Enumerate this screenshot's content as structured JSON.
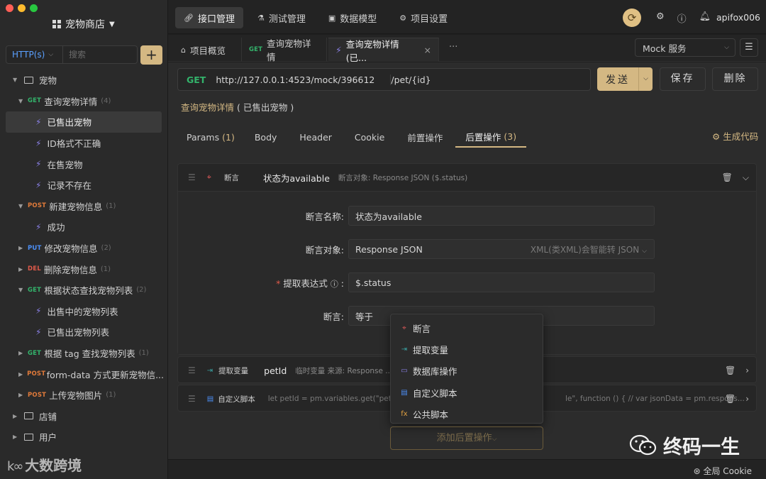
{
  "window": {
    "traffic_colors": [
      "#ff5f57",
      "#febc2e",
      "#28c840"
    ]
  },
  "sidebar": {
    "project_name": "宠物商店",
    "http_select": "HTTP(s)",
    "search_placeholder": "搜索",
    "add_label": "+",
    "tree": [
      {
        "type": "folder",
        "label": "宠物",
        "expanded": true
      },
      {
        "type": "api",
        "method": "GET",
        "label": "查询宠物详情",
        "count": "(4)",
        "expanded": true
      },
      {
        "type": "case",
        "label": "已售出宠物",
        "active": true
      },
      {
        "type": "case",
        "label": "ID格式不正确"
      },
      {
        "type": "case",
        "label": "在售宠物"
      },
      {
        "type": "case",
        "label": "记录不存在"
      },
      {
        "type": "api",
        "method": "POST",
        "label": "新建宠物信息",
        "count": "(1)",
        "expanded": true
      },
      {
        "type": "case",
        "label": "成功"
      },
      {
        "type": "api",
        "method": "PUT",
        "label": "修改宠物信息",
        "count": "(2)",
        "expanded": false
      },
      {
        "type": "api",
        "method": "DEL",
        "label": "删除宠物信息",
        "count": "(1)",
        "expanded": false
      },
      {
        "type": "api",
        "method": "GET",
        "label": "根据状态查找宠物列表",
        "count": "(2)",
        "expanded": true
      },
      {
        "type": "case",
        "label": "出售中的宠物列表"
      },
      {
        "type": "case",
        "label": "已售出宠物列表"
      },
      {
        "type": "api",
        "method": "GET",
        "label": "根据 tag 查找宠物列表",
        "count": "(1)",
        "expanded": false
      },
      {
        "type": "api",
        "method": "POST",
        "label": "form-data 方式更新宠物信...",
        "count": "",
        "expanded": false
      },
      {
        "type": "api",
        "method": "POST",
        "label": "上传宠物图片",
        "count": "(1)",
        "expanded": false
      },
      {
        "type": "folder",
        "label": "店铺",
        "expanded": false
      },
      {
        "type": "folder",
        "label": "用户",
        "expanded": false
      }
    ],
    "watermark": "大数跨境"
  },
  "topnav": {
    "items": [
      {
        "label": "接口管理",
        "icon": "link-icon",
        "active": true
      },
      {
        "label": "测试管理",
        "icon": "flask-icon",
        "active": false
      },
      {
        "label": "数据模型",
        "icon": "cube-icon",
        "active": false
      },
      {
        "label": "项目设置",
        "icon": "gear-icon",
        "active": false
      }
    ],
    "username": "apifox006"
  },
  "tabs": {
    "items": [
      {
        "label": "项目概览",
        "prefix": ""
      },
      {
        "label": "查询宠物详情",
        "prefix": "GET"
      },
      {
        "label": "查询宠物详情 (已...",
        "prefix": ""
      }
    ],
    "more": "···",
    "mock_service": "Mock 服务"
  },
  "request": {
    "method": "GET",
    "base_url": "http://127.0.0.1:4523/mock/396612",
    "path": "/pet/{id}",
    "send_label": "发送",
    "save_label": "保存",
    "delete_label": "删除",
    "breadcrumb_name": "查询宠物详情",
    "breadcrumb_case": "( 已售出宠物 )"
  },
  "subtabs": [
    {
      "label": "Params",
      "count": "(1)"
    },
    {
      "label": "Body",
      "count": ""
    },
    {
      "label": "Header",
      "count": ""
    },
    {
      "label": "Cookie",
      "count": ""
    },
    {
      "label": "前置操作",
      "count": ""
    },
    {
      "label": "后置操作",
      "count": "(3)",
      "active": true
    }
  ],
  "gen_code": "生成代码",
  "assertion": {
    "type": "断言",
    "name": "状态为available",
    "desc": "断言对象: Response JSON ($.status)",
    "form": {
      "name_label": "断言名称:",
      "name_value": "状态为available",
      "target_label": "断言对象:",
      "target_value": "Response JSON",
      "target_hint": "XML(类XML)会智能转 JSON",
      "expr_label": "提取表达式",
      "expr_value": "$.status",
      "op_label": "断言:",
      "op_value": "等于"
    }
  },
  "extract": {
    "type": "提取变量",
    "name": "petId",
    "desc": "临时变量   来源: Response ..."
  },
  "script": {
    "type": "自定义脚本",
    "code": "let petId = pm.variables.get(\"petId\"),",
    "code_tail": "le\", function () { // var jsonData = pm.respons..."
  },
  "popup": [
    {
      "label": "断言",
      "icon": "target-icon",
      "color": "#e05a5a"
    },
    {
      "label": "提取变量",
      "icon": "extract-icon",
      "color": "#3aa0a0"
    },
    {
      "label": "数据库操作",
      "icon": "database-icon",
      "color": "#8a80e6"
    },
    {
      "label": "自定义脚本",
      "icon": "script-icon",
      "color": "#4c8ff7"
    },
    {
      "label": "公共脚本",
      "icon": "fx-icon",
      "color": "#e0a040"
    }
  ],
  "add_op": "添加后置操作",
  "watermark_right": "终码一生",
  "footer": {
    "global_cookie": "全局 Cookie"
  }
}
